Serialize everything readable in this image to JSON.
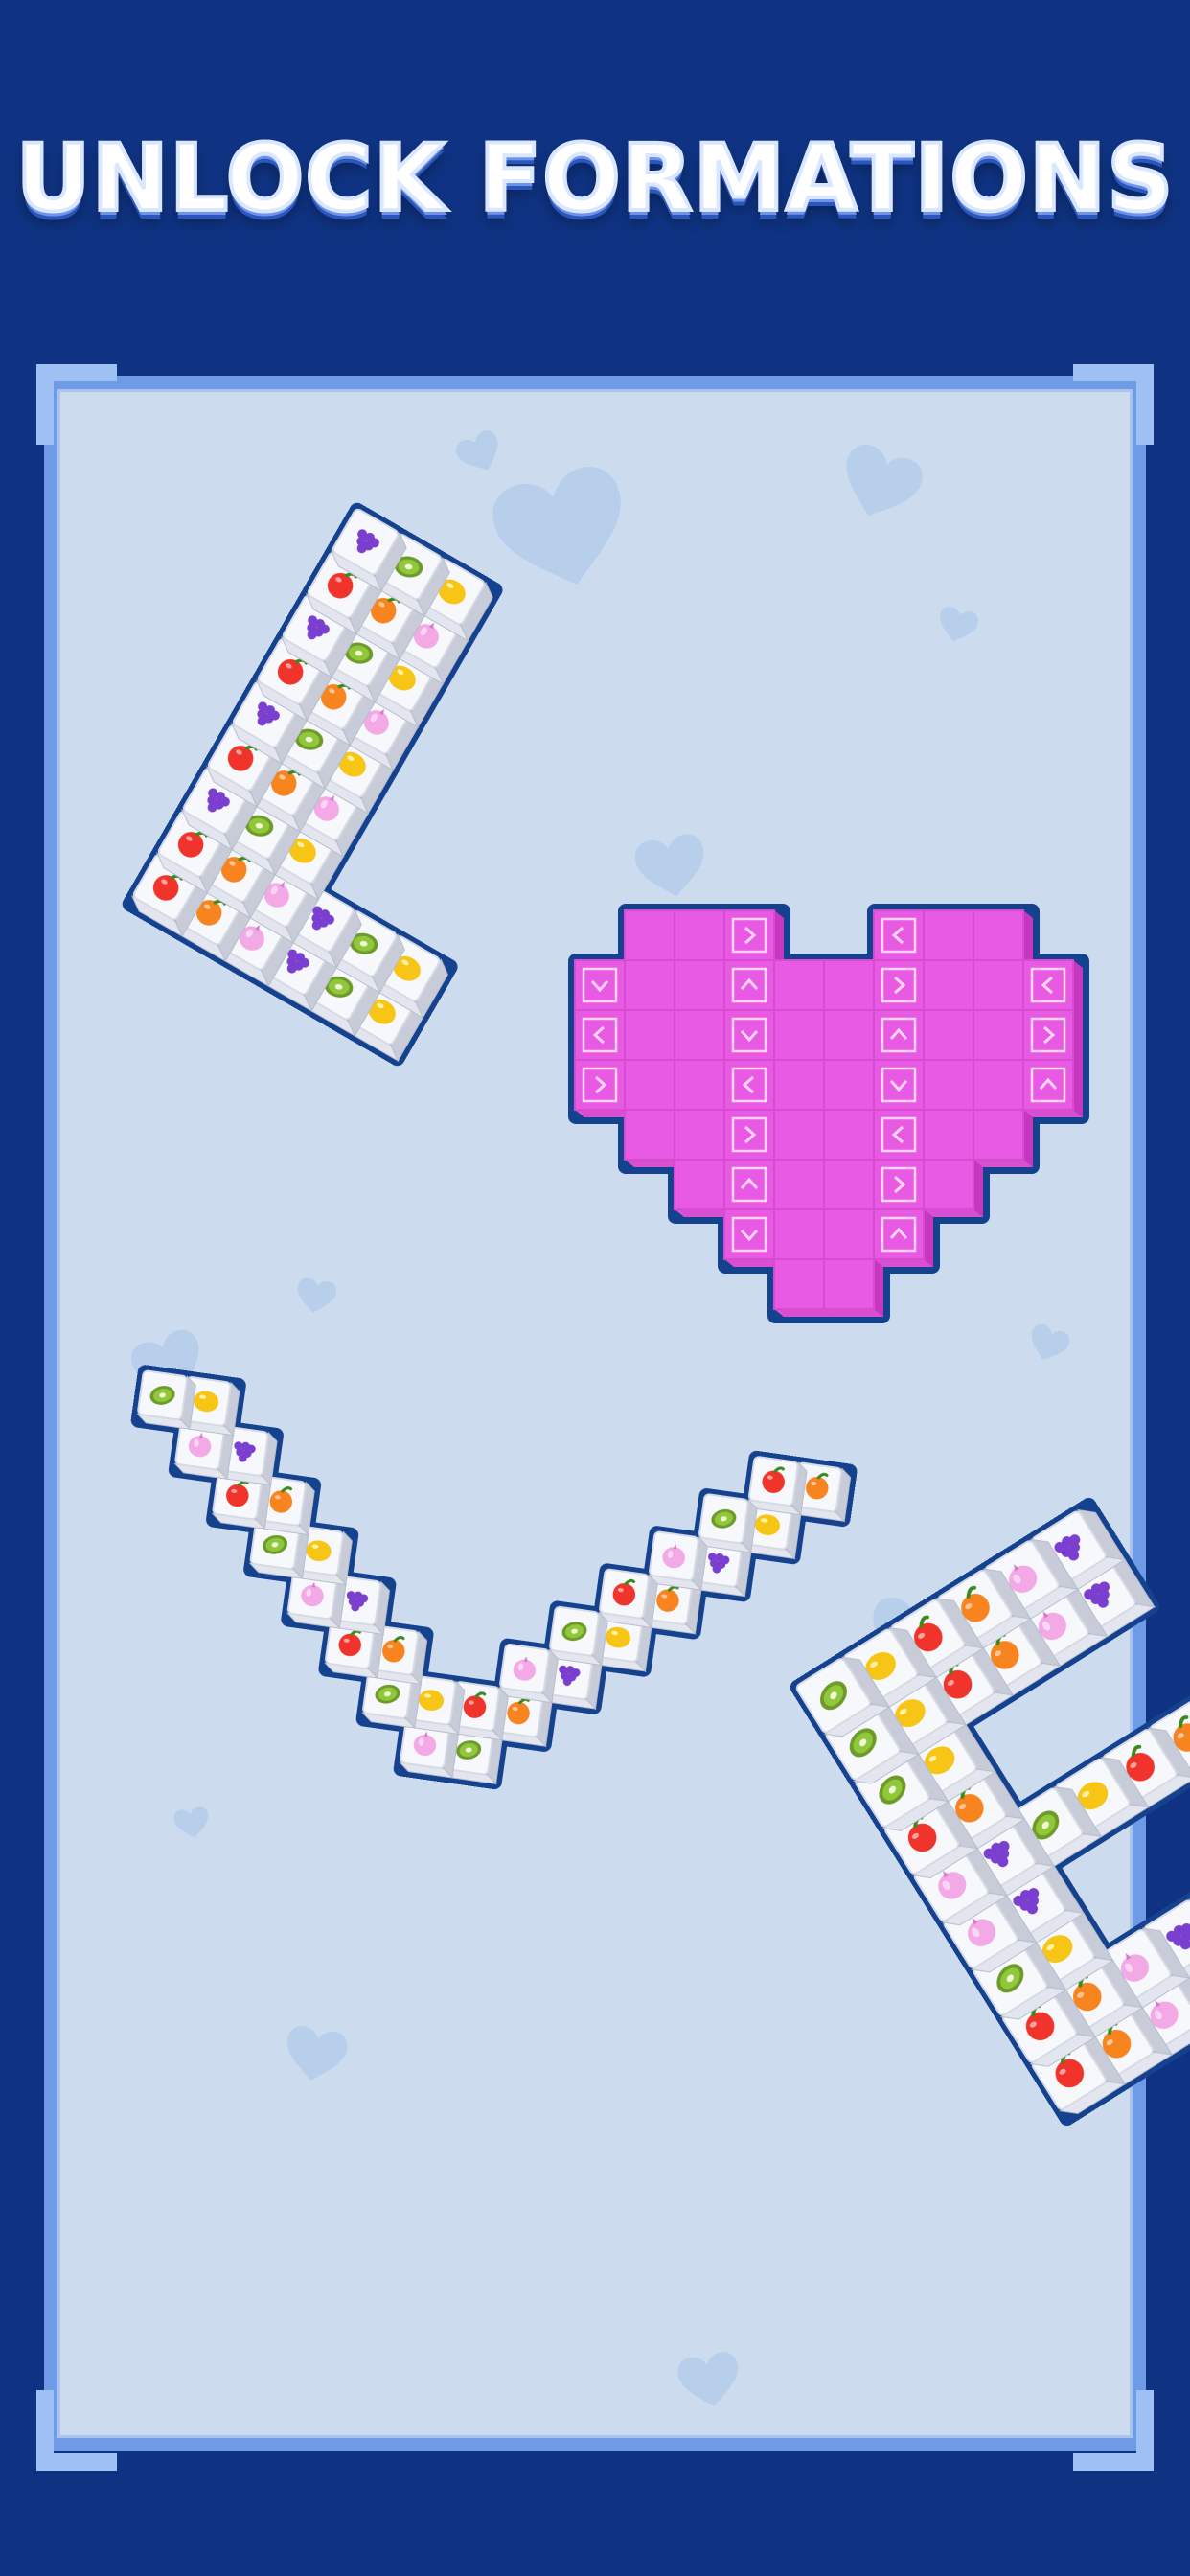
{
  "header": {
    "title": "UNLOCK FORMATIONS"
  },
  "colors": {
    "page_background": "#0f3382",
    "title_text": "#ffffff",
    "title_shadow": "#2b57bd",
    "frame_border": "#6f9ae6",
    "frame_fill": "#ccdcee",
    "decor_hearts": "#b5cdeb",
    "tile_top": "#f7f8fb",
    "tile_side_light": "#e3e6ee",
    "tile_side_dark": "#c7ccd8",
    "formation_outline": "#15428f",
    "heart_tile": "#e85ae3",
    "heart_tile_side": "#c736bf",
    "heart_tile_mark": "#fbd3f8"
  },
  "scene": {
    "letters_icon": [
      "L",
      "heart-formation",
      "V",
      "E"
    ],
    "fruit_icons": [
      "onion-icon",
      "orange-icon",
      "apple-icon",
      "lemon-icon",
      "kiwi-icon",
      "grape-icon"
    ],
    "arrow_icons": [
      "arrow-up-icon",
      "arrow-down-icon",
      "arrow-left-icon",
      "arrow-right-icon"
    ]
  }
}
